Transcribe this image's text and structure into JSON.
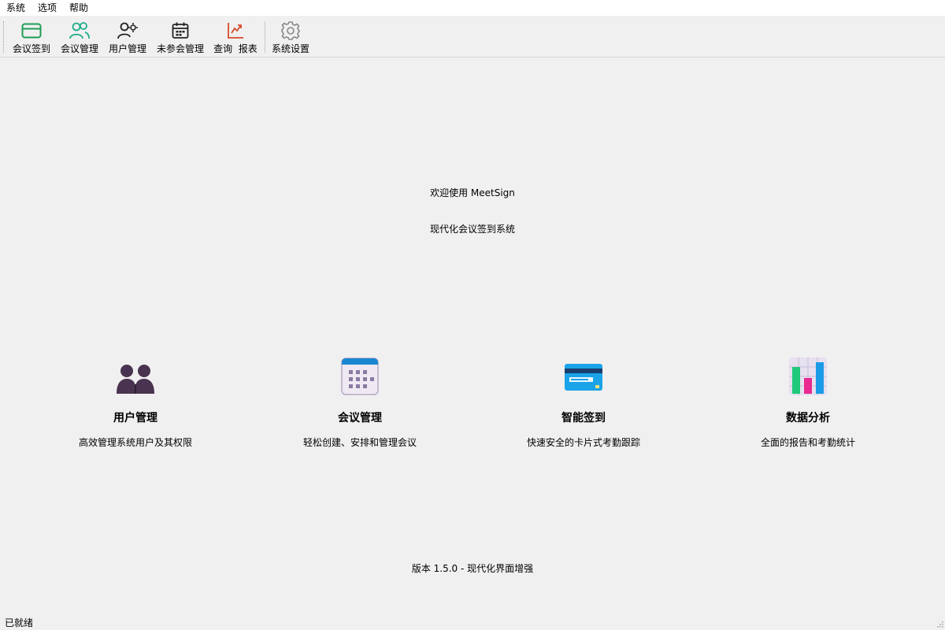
{
  "menu": {
    "items": [
      "系统",
      "选项",
      "帮助"
    ]
  },
  "toolbar": {
    "buttons": [
      {
        "label": "会议签到",
        "icon": "credit-card-icon",
        "color": "#1f9d55"
      },
      {
        "label": "会议管理",
        "icon": "users-icon",
        "color": "#1fae8a"
      },
      {
        "label": "用户管理",
        "icon": "user-settings-icon",
        "color": "#222222"
      },
      {
        "label": "未参会管理",
        "icon": "calendar-icon",
        "color": "#222222"
      },
      {
        "label": "查询  报表",
        "icon": "chart-line-icon",
        "color": "#d94a2b"
      },
      {
        "label": "系统设置",
        "icon": "gear-icon",
        "color": "#888888"
      }
    ]
  },
  "welcome": {
    "title": "欢迎使用 MeetSign",
    "subtitle": "现代化会议签到系统"
  },
  "features": [
    {
      "title": "用户管理",
      "desc": "高效管理系统用户及其权限",
      "icon": "people-icon"
    },
    {
      "title": "会议管理",
      "desc": "轻松创建、安排和管理会议",
      "icon": "calendar-icon"
    },
    {
      "title": "智能签到",
      "desc": "快速安全的卡片式考勤跟踪",
      "icon": "card-icon"
    },
    {
      "title": "数据分析",
      "desc": "全面的报告和考勤统计",
      "icon": "bar-chart-icon"
    }
  ],
  "version": "版本 1.5.0 - 现代化界面增强",
  "status": "已就绪"
}
